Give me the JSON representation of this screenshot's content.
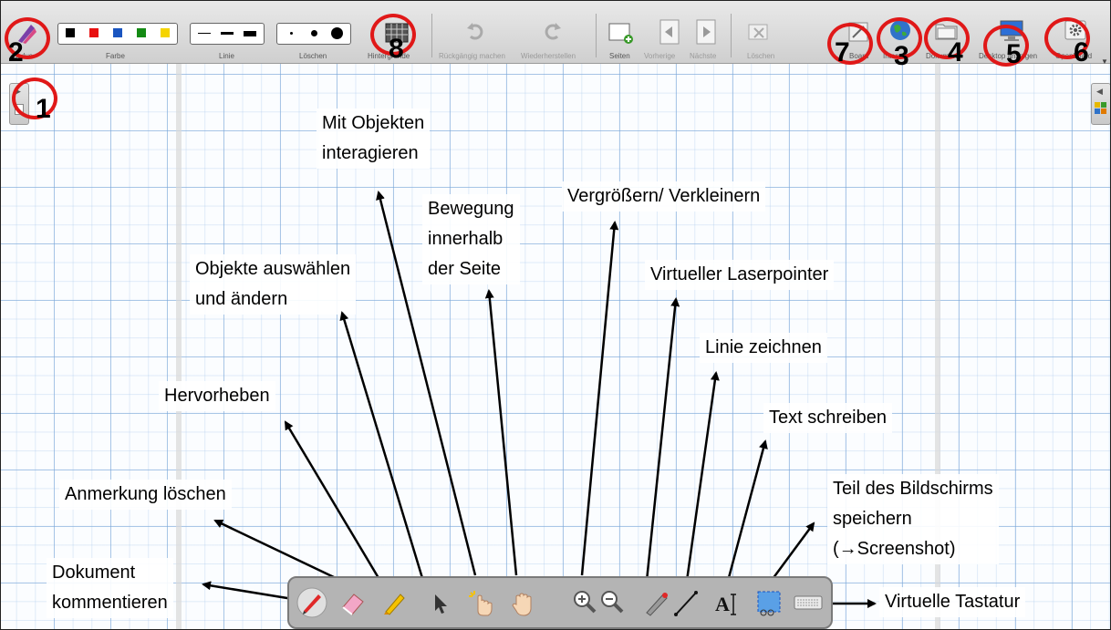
{
  "toolbar": {
    "stylus_label": "Stylus",
    "color_label": "Farbe",
    "line_label": "Linie",
    "erase_label": "Löschen",
    "background_label": "Hintergründe",
    "undo_label": "Rückgängig machen",
    "redo_label": "Wiederherstellen",
    "pages_label": "Seiten",
    "previous_label": "Vorherige",
    "next_label": "Nächste",
    "delete_label": "Löschen",
    "board_label": "Board",
    "internet_label": "Internet",
    "documents_label": "Dokumente",
    "desktop_label": "Desktop anzeigen",
    "open_label": "Openboard",
    "colors": [
      "#000000",
      "#e81010",
      "#1a55c0",
      "#148a14",
      "#f5d400"
    ]
  },
  "markers": [
    "1",
    "2",
    "3",
    "4",
    "5",
    "6",
    "7",
    "8"
  ],
  "labels": {
    "interact": "Mit Objekten\ninteragieren",
    "move": "Bewegung\ninnerhalb\nder Seite",
    "zoom": "Vergrößern/ Verkleinern",
    "select": "Objekte auswählen\nund ändern",
    "laser": "Virtueller Laserpointer",
    "line": "Linie zeichnen",
    "highlight": "Hervorheben",
    "text": "Text schreiben",
    "erase": "Anmerkung löschen",
    "capture": "Teil des Bildschirms\nspeichern\n(→Screenshot)",
    "annotate": "Dokument\nkommentieren",
    "keyboard": "Virtuelle Tastatur"
  },
  "bottom_tools": [
    "pen-icon",
    "eraser-icon",
    "highlighter-icon",
    "pointer-icon",
    "interact-hand-icon",
    "move-hand-icon",
    "zoom-in-icon",
    "zoom-out-icon",
    "laser-pointer-icon",
    "line-icon",
    "text-icon",
    "capture-icon",
    "keyboard-icon"
  ]
}
